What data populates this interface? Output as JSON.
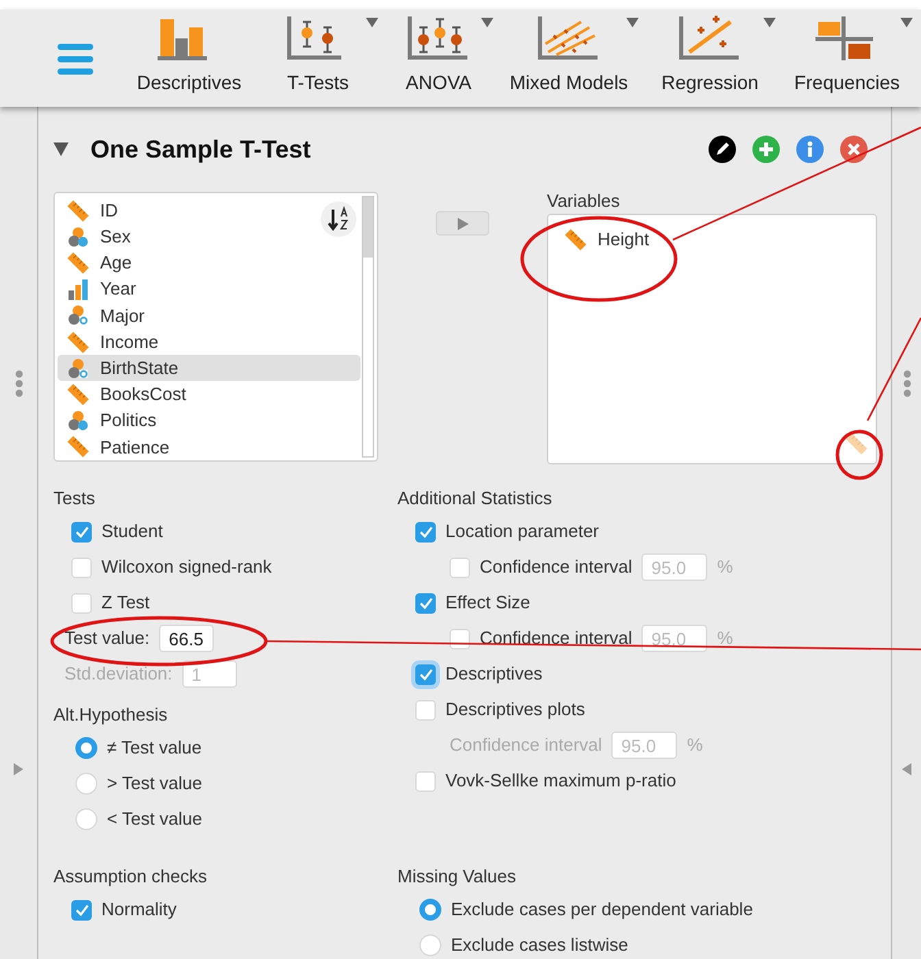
{
  "toolbar": {
    "tools": [
      {
        "kind": "descriptives",
        "label": "Descriptives",
        "dropdown": false
      },
      {
        "kind": "ttests",
        "label": "T-Tests",
        "dropdown": true
      },
      {
        "kind": "anova",
        "label": "ANOVA",
        "dropdown": true
      },
      {
        "kind": "mixed",
        "label": "Mixed Models",
        "dropdown": true
      },
      {
        "kind": "regression",
        "label": "Regression",
        "dropdown": true
      },
      {
        "kind": "frequencies",
        "label": "Frequencies",
        "dropdown": true
      }
    ]
  },
  "analysis": {
    "title": "One Sample T-Test",
    "expanded": true
  },
  "source_variables": [
    {
      "name": "ID",
      "kind": "continuous",
      "selected": false
    },
    {
      "name": "Sex",
      "kind": "nominal",
      "selected": false
    },
    {
      "name": "Age",
      "kind": "continuous",
      "selected": false
    },
    {
      "name": "Year",
      "kind": "ordinal",
      "selected": false
    },
    {
      "name": "Major",
      "kind": "nominal_text",
      "selected": false
    },
    {
      "name": "Income",
      "kind": "continuous",
      "selected": false
    },
    {
      "name": "BirthState",
      "kind": "nominal_text",
      "selected": true
    },
    {
      "name": "BooksCost",
      "kind": "continuous",
      "selected": false
    },
    {
      "name": "Politics",
      "kind": "nominal",
      "selected": false
    },
    {
      "name": "Patience",
      "kind": "continuous",
      "selected": false
    }
  ],
  "variables": {
    "label": "Variables",
    "items": [
      {
        "name": "Height",
        "kind": "continuous"
      }
    ],
    "accepts": [
      {
        "kind": "continuous"
      }
    ]
  },
  "tests": {
    "header": "Tests",
    "items": [
      {
        "kind": "checkbox",
        "label": "Student",
        "checked": true
      },
      {
        "kind": "checkbox",
        "label": "Wilcoxon signed-rank",
        "checked": false
      },
      {
        "kind": "checkbox",
        "label": "Z Test",
        "checked": false
      },
      {
        "kind": "field",
        "label": "Test value:",
        "value": "66.5",
        "disabled": false
      },
      {
        "kind": "field",
        "label": "Std.deviation:",
        "value": "1",
        "disabled": true
      }
    ]
  },
  "alt_hypothesis": {
    "header": "Alt.Hypothesis",
    "options": [
      {
        "label": "≠ Test value",
        "selected": true
      },
      {
        "label": "> Test value",
        "selected": false
      },
      {
        "label": "< Test value",
        "selected": false
      }
    ]
  },
  "assumption_checks": {
    "header": "Assumption checks",
    "items": [
      {
        "kind": "checkbox",
        "label": "Normality",
        "checked": true
      }
    ]
  },
  "additional_statistics": {
    "header": "Additional Statistics",
    "items": [
      {
        "kind": "checkbox",
        "label": "Location parameter",
        "checked": true,
        "focused": false,
        "children": [
          {
            "kind": "checkbox",
            "label": "Confidence interval",
            "checked": false,
            "focused": false,
            "value": "95.0",
            "value_disabled": true,
            "suffix": "%"
          }
        ]
      },
      {
        "kind": "checkbox",
        "label": "Effect Size",
        "checked": true,
        "focused": false,
        "children": [
          {
            "kind": "checkbox",
            "label": "Confidence interval",
            "checked": false,
            "focused": false,
            "value": "95.0",
            "value_disabled": true,
            "suffix": "%"
          }
        ]
      },
      {
        "kind": "checkbox",
        "label": "Descriptives",
        "checked": true,
        "focused": true
      },
      {
        "kind": "checkbox",
        "label": "Descriptives plots",
        "checked": false,
        "focused": false,
        "children": [
          {
            "kind": "field",
            "label": "Confidence interval",
            "disabled": true,
            "value": "95.0",
            "value_disabled": true,
            "suffix": "%"
          }
        ]
      },
      {
        "kind": "checkbox",
        "label": "Vovk-Sellke maximum p-ratio",
        "checked": false,
        "focused": false
      }
    ]
  },
  "missing_values": {
    "header": "Missing Values",
    "options": [
      {
        "label": "Exclude cases per dependent variable",
        "selected": true
      },
      {
        "label": "Exclude cases listwise",
        "selected": false
      }
    ]
  }
}
